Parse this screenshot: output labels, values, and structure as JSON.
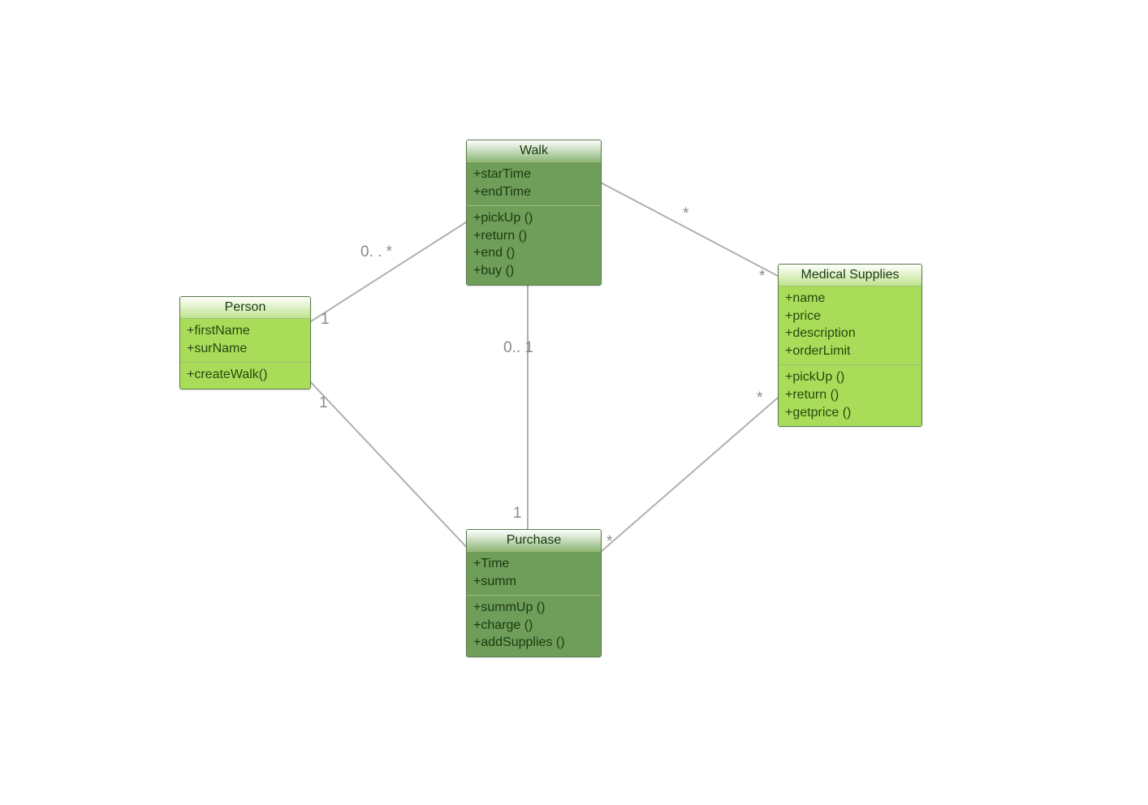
{
  "classes": {
    "person": {
      "name": "Person",
      "attributes": [
        "+firstName",
        "+surName"
      ],
      "methods": [
        "+createWalk()"
      ]
    },
    "walk": {
      "name": "Walk",
      "attributes": [
        "+starTime",
        "+endTime"
      ],
      "methods": [
        "+pickUp ()",
        "+return ()",
        "+end ()",
        "+buy ()"
      ]
    },
    "purchase": {
      "name": "Purchase",
      "attributes": [
        "+Time",
        "+summ"
      ],
      "methods": [
        "+summUp ()",
        "+charge ()",
        "+addSupplies ()"
      ]
    },
    "medical": {
      "name": "Medical Supplies",
      "attributes": [
        "+name",
        "+price",
        "+description",
        "+orderLimit"
      ],
      "methods": [
        "+pickUp ()",
        "+return ()",
        "+getprice ()"
      ]
    }
  },
  "multiplicities": {
    "person_walk_person": "1",
    "person_walk_walk": "0. . *",
    "person_purchase_person": "1",
    "walk_purchase_walk": "0.. 1",
    "walk_purchase_purchase": "1",
    "walk_medical_walk": "*",
    "walk_medical_medical": "*",
    "purchase_medical_purchase": "*",
    "purchase_medical_medical": "*"
  }
}
